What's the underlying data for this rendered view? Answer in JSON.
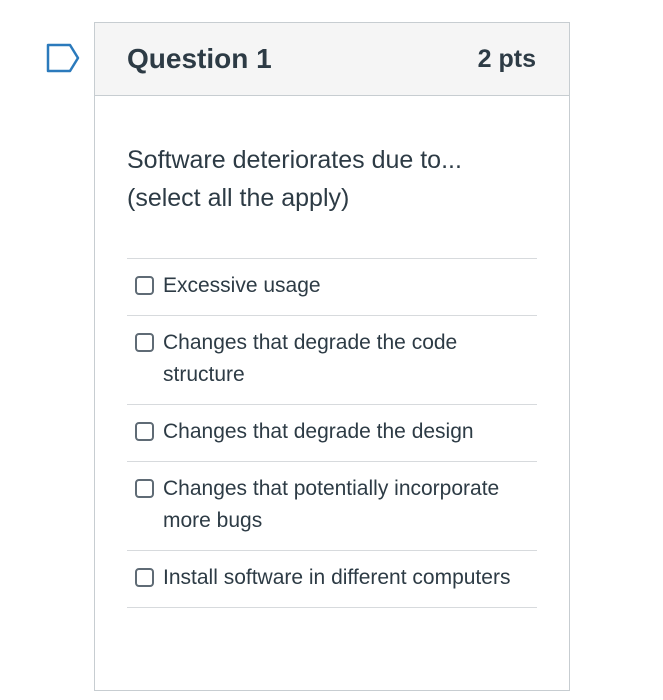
{
  "question": {
    "title": "Question 1",
    "points": "2 pts",
    "text_lines": [
      "Software deteriorates due to...",
      "(select all the apply)"
    ],
    "answers": [
      {
        "label": "Excessive usage",
        "checked": false
      },
      {
        "label": "Changes that degrade the code structure",
        "checked": false
      },
      {
        "label": "Changes that degrade the design",
        "checked": false
      },
      {
        "label": "Changes that potentially incorporate more bugs",
        "checked": false
      },
      {
        "label": "Install software in different computers",
        "checked": false
      }
    ]
  },
  "icons": {
    "flag": "bookmark-flag-icon"
  },
  "colors": {
    "text": "#2d3b45",
    "header_bg": "#f5f5f5",
    "border": "#c7cdd1",
    "flag_stroke": "#2b7abc"
  }
}
